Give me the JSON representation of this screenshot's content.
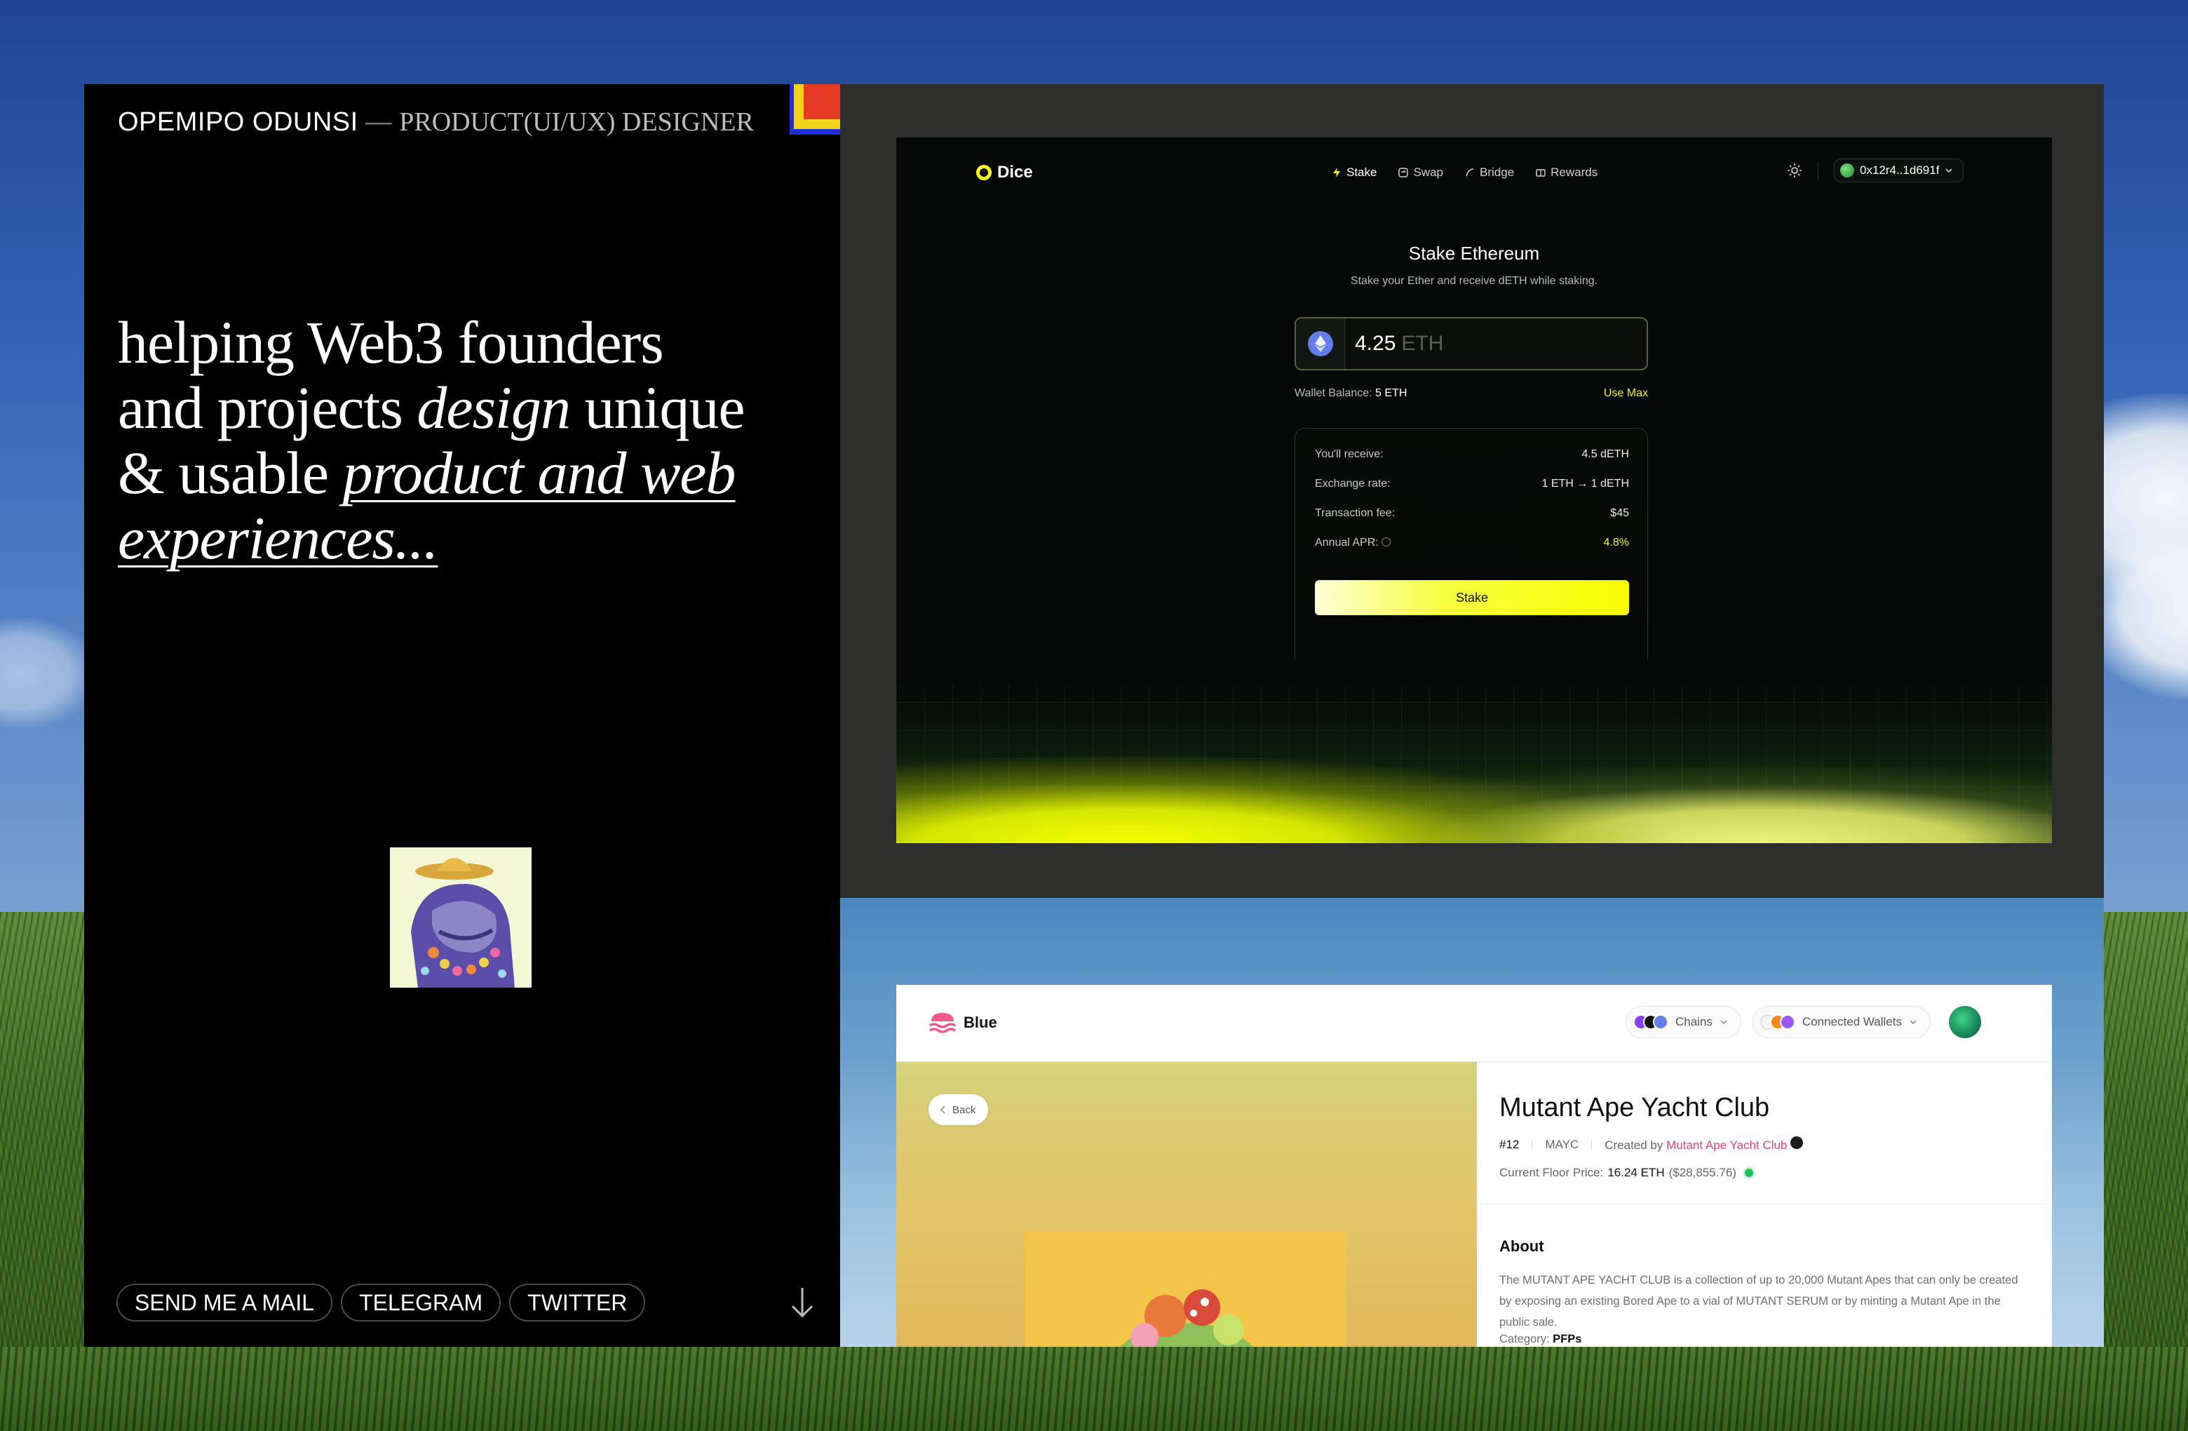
{
  "left": {
    "name": "OPEMIPO ODUNSI",
    "dash": "—",
    "role": "PRODUCT(UI/UX) DESIGNER",
    "hero": {
      "p1": "helping Web3 founders and projects ",
      "em1": "design",
      "p2": " unique & usable ",
      "link": "product and web experiences..."
    },
    "contacts": [
      "SEND ME A MAIL",
      "TELEGRAM",
      "TWITTER"
    ]
  },
  "dice": {
    "brand": "Dice",
    "nav": [
      "Stake",
      "Swap",
      "Bridge",
      "Rewards"
    ],
    "wallet_address": "0x12r4..1d691f",
    "title": "Stake Ethereum",
    "subtitle": "Stake your Ether and receive dETH while staking.",
    "amount": "4.25",
    "amount_unit": "ETH",
    "wallet_balance_label": "Wallet Balance:",
    "wallet_balance_value": "5 ETH",
    "use_max": "Use Max",
    "details": [
      {
        "label": "You'll receive:",
        "value": "4.5 dETH"
      },
      {
        "label": "Exchange rate:",
        "value": "1 ETH → 1 dETH"
      },
      {
        "label": "Transaction fee:",
        "value": "$45"
      },
      {
        "label": "Annual APR:",
        "value": "4.8%"
      }
    ],
    "stake_button": "Stake",
    "accent_color": "#f7ff00"
  },
  "blue": {
    "brand": "Blue",
    "chains_label": "Chains",
    "wallets_label": "Connected Wallets",
    "back_label": "Back",
    "nft_title": "Mutant Ape Yacht Club",
    "token_number": "#12",
    "ticker": "MAYC",
    "created_by_label": "Created by",
    "creator": "Mutant Ape Yacht Club",
    "floor_label": "Current Floor Price:",
    "floor_eth": "16.24 ETH",
    "floor_usd": "($28,855.76)",
    "about_title": "About",
    "about_text": "The MUTANT APE YACHT CLUB is a collection of up to 20,000 Mutant Apes that can only be created by exposing an existing Bored Ape to a vial of MUTANT SERUM or by minting a Mutant Ape in the public sale.",
    "category_label": "Category:",
    "category_value": "PFPs",
    "accent_color": "#e2407f"
  }
}
